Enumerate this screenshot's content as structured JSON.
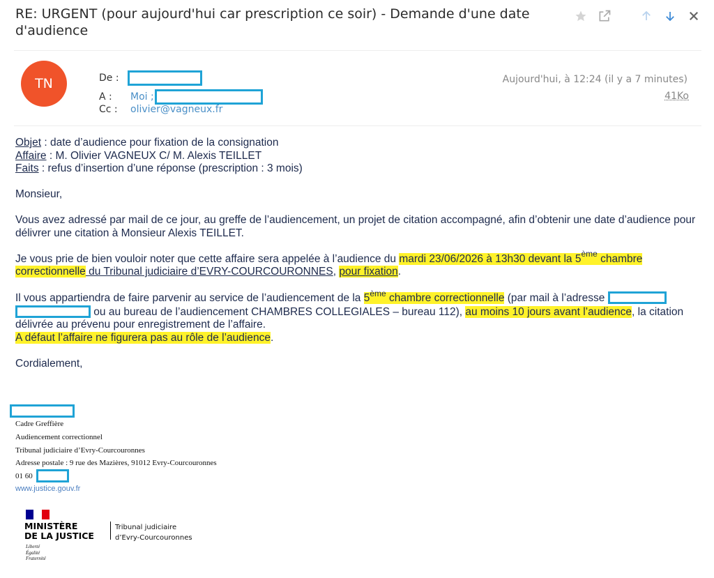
{
  "email": {
    "subject": "RE: URGENT (pour aujourd'hui car prescription ce soir) - Demande d'une date d'audience",
    "toolbar": [
      {
        "name": "star-icon"
      },
      {
        "name": "open-external-icon"
      },
      {
        "name": "arrow-up-icon"
      },
      {
        "name": "arrow-down-icon"
      },
      {
        "name": "close-icon"
      }
    ],
    "sender_initials": "TN",
    "avatar_color": "#f0532a",
    "from_label": "De :",
    "to_label": "A :",
    "to_value": "Moi ;",
    "cc_label": "Cc :",
    "cc_value": "olivier@vagneux.fr",
    "date": "Aujourd'hui, à 12:24 (il y a 7 minutes)",
    "size": "41Ko",
    "link_color": "#4a8fc7",
    "redaction_color": "#1fa3d6",
    "highlight_color": "#fff22a"
  },
  "body": {
    "objet_label": "Objet",
    "objet_text": " : date d’audience pour fixation de la consignation",
    "affaire_label": "Affaire",
    "affaire_text": " : M. Olivier VAGNEUX C/ M. Alexis TEILLET",
    "faits_label": "Faits",
    "faits_text": " : refus d’insertion d’une réponse (prescription : 3 mois)",
    "greeting": "Monsieur,",
    "para1": "Vous avez adressé par mail de ce jour, au greffe de l’audiencement, un projet de citation accompagné, afin d’obtenir une date d’audience pour délivrer une citation à Monsieur Alexis TEILLET.",
    "para2_a": "Je vous prie de bien vouloir noter que cette affaire sera appelée à l’audience du ",
    "para2_hl1": "mardi 23/06/2026 à 13h30 devant la 5",
    "para2_sup": "ème",
    "para2_hl2": " chambre correctionnelle",
    "para2_b": " du Tribunal judiciaire d’EVRY-COURCOURONNES",
    "para2_c": ", ",
    "para2_hl3": "pour fixation",
    "para2_d": ".",
    "para3_a": "Il vous appartiendra de faire parvenir au service de l’audiencement de la ",
    "para3_hl1": "5",
    "para3_sup": "ème",
    "para3_hl2": " chambre correctionnelle",
    "para3_b": " (par mail à l’adresse ",
    "para3_c": " ou au bureau de l’audiencement CHAMBRES COLLEGIALES – bureau 112), ",
    "para3_hl3": "au moins 10 jours avant l’audience",
    "para3_d": ", la citation délivrée au prévenu pour enregistrement de l’affaire.",
    "para4_hl": "A défaut l’affaire ne figurera pas au rôle de l’audience",
    "para4_end": ".",
    "closing": "Cordialement,"
  },
  "signature": {
    "role": "Cadre Greffière",
    "service": "Audiencement correctionnel",
    "court": "Tribunal judiciaire d’Evry-Courcouronnes",
    "address": "Adresse postale : 9 rue des Mazières, 91012 Evry-Courcouronnes",
    "phone_prefix": "01 60",
    "website": "www.justice.gouv.fr"
  },
  "logo": {
    "line1": "MINISTÈRE",
    "line2": "DE LA JUSTICE",
    "motto1": "Liberté",
    "motto2": "Égalité",
    "motto3": "Fraternité",
    "court_line1": "Tribunal judiciaire",
    "court_line2": "d’Evry-Courcouronnes"
  }
}
